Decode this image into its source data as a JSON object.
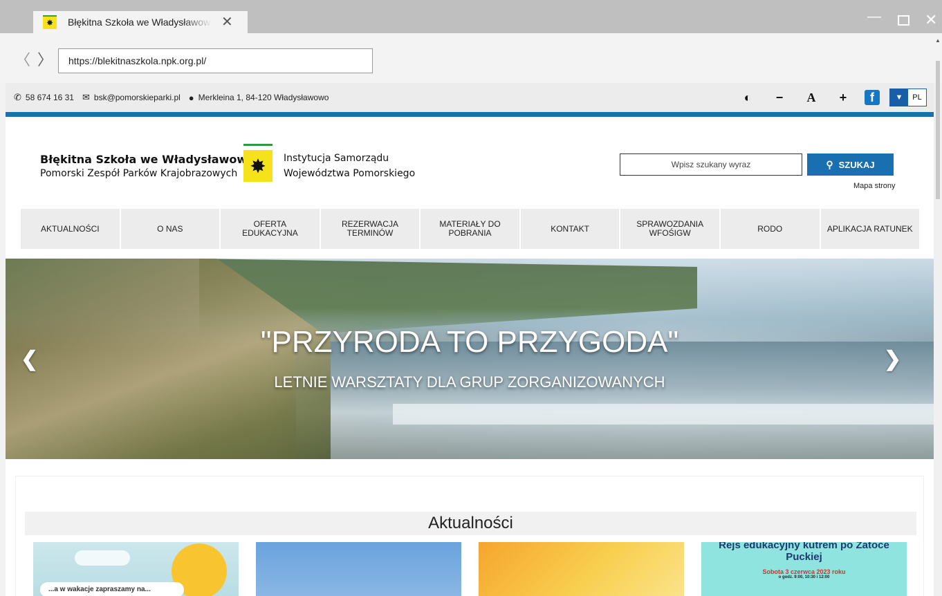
{
  "browser": {
    "tab_title": "Błękitna Szkoła we Władysławowie",
    "url": "https://blekitnaszkola.npk.org.pl/"
  },
  "topbar": {
    "phone": "58 674 16 31",
    "email": "bsk@pomorskieparki.pl",
    "address": "Merkleina 1, 84-120 Władysławowo",
    "lang": "PL"
  },
  "header": {
    "brand_name": "Błękitna Szkoła we Władysławowie",
    "brand_sub": "Pomorski Zespół Parków Krajobrazowych",
    "inst_line1": "Instytucja Samorządu",
    "inst_line2": "Województwa Pomorskiego",
    "search_placeholder": "Wpisz szukany wyraz",
    "search_button": "SZUKAJ",
    "sitemap": "Mapa strony"
  },
  "menu": [
    {
      "label": "AKTUALNOŚCI"
    },
    {
      "label": "O NAS"
    },
    {
      "label": "OFERTA EDUKACYJNA"
    },
    {
      "label": "REZERWACJA TERMINÓW"
    },
    {
      "label": "MATERIAŁY DO POBRANIA"
    },
    {
      "label": "KONTAKT"
    },
    {
      "label": "SPRAWOZDANIA WFOŚIGW"
    },
    {
      "label": "RODO"
    },
    {
      "label": "APLIKACJA RATUNEK"
    }
  ],
  "hero": {
    "headline": "\"PRZYRODA TO PRZYGODA\"",
    "subline": "LETNIE WARSZTATY DLA GRUP ZORGANIZOWANYCH"
  },
  "news": {
    "heading": "Aktualności",
    "card1_text": "...a w wakacje zapraszamy na...",
    "card4_title": "Rejs edukacyjny kutrem po Zatoce Puckiej",
    "card4_date": "Sobota 3 czerwca 2023 roku",
    "card4_hours": "o godz. 9:00, 10:30 i 12:00"
  },
  "colors": {
    "accent_blue": "#1a6fb0",
    "crest_yellow": "#f6e21a"
  }
}
